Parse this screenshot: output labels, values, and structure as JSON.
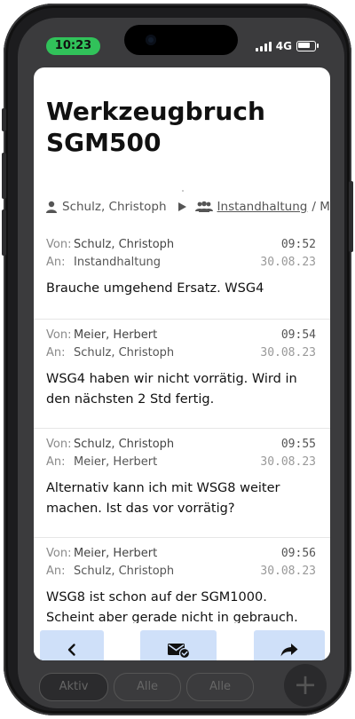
{
  "status_bar": {
    "time": "10:23",
    "network": "4G"
  },
  "thread": {
    "title": "Werkzeugbruch SGM500",
    "route": {
      "from": "Schulz, Christoph",
      "to_group": "Instandhaltung",
      "to_rest": "/ M"
    }
  },
  "labels": {
    "from": "Von:",
    "to": "An:"
  },
  "messages": [
    {
      "from": "Schulz, Christoph",
      "to": "Instandhaltung",
      "time": "09:52",
      "date": "30.08.23",
      "text": "Brauche umgehend Ersatz. WSG4"
    },
    {
      "from": "Meier, Herbert",
      "to": "Schulz, Christoph",
      "time": "09:54",
      "date": "30.08.23",
      "text": "WSG4 haben wir nicht vorrätig. Wird in den nächsten 2 Std fertig."
    },
    {
      "from": "Schulz, Christoph",
      "to": "Meier, Herbert",
      "time": "09:55",
      "date": "30.08.23",
      "text": "Alternativ kann ich mit WSG8 weiter machen. Ist das vor vorrätig?"
    },
    {
      "from": "Meier, Herbert",
      "to": "Schulz, Christoph",
      "time": "09:56",
      "date": "30.08.23",
      "text": "WSG8 ist schon auf der SGM1000. Scheint aber gerade nicht in gebrauch."
    }
  ],
  "filters": {
    "active": "Aktiv",
    "all1": "Alle",
    "all2": "Alle"
  },
  "fab_label": "+",
  "icons": {
    "back": "chevron-left-icon",
    "mail": "mail-check-icon",
    "forward": "forward-arrow-icon",
    "person": "person-icon",
    "group": "group-icon",
    "play": "play-triangle-icon"
  },
  "colors": {
    "action_button": "#cfe0f9",
    "status_pill": "#31c25a"
  }
}
